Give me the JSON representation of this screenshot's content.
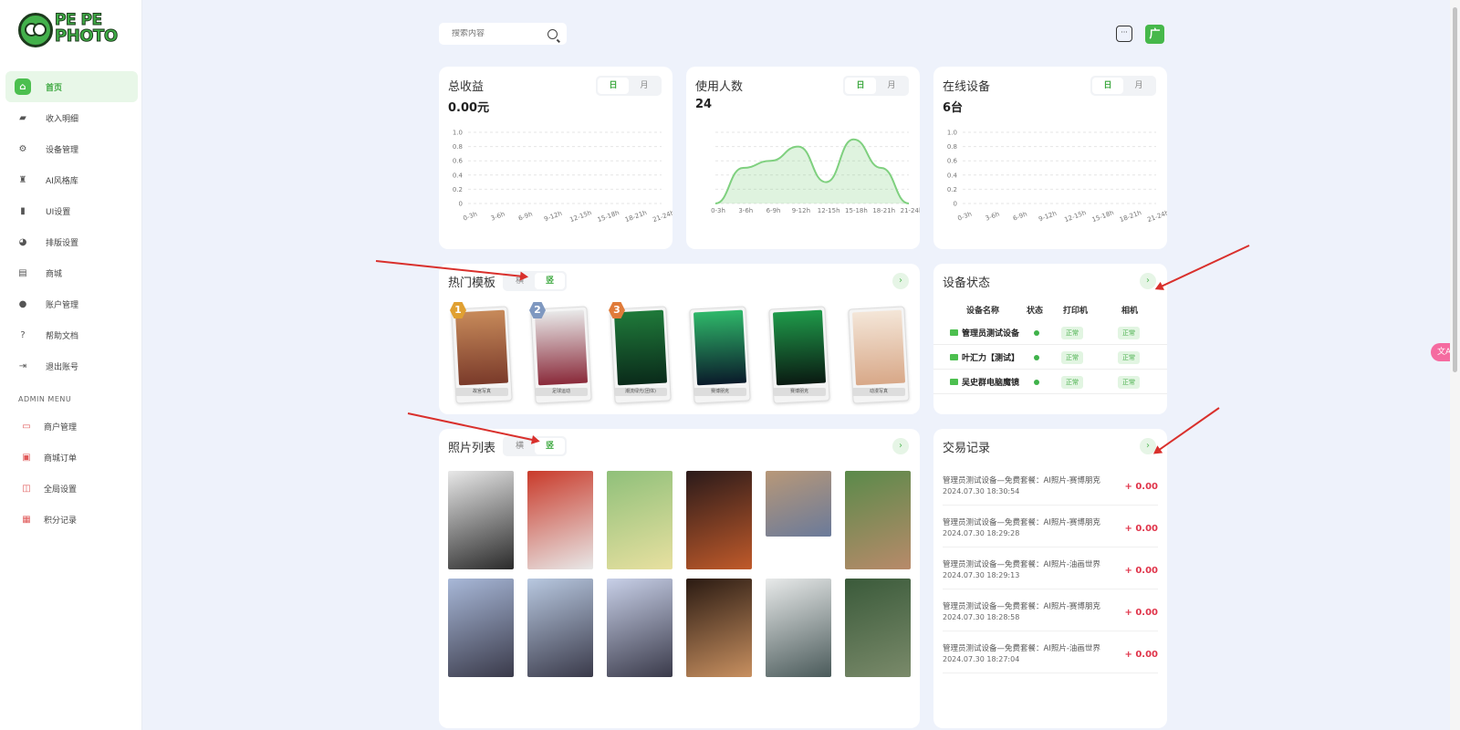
{
  "brand": {
    "line1": "PE PE",
    "line2": "PHOTO"
  },
  "nav": {
    "items": [
      {
        "label": "首页",
        "icon": "home-icon",
        "glyph": "⌂"
      },
      {
        "label": "收入明细",
        "icon": "wallet-icon",
        "glyph": "▰"
      },
      {
        "label": "设备管理",
        "icon": "gear-icon",
        "glyph": "⚙"
      },
      {
        "label": "AI风格库",
        "icon": "stamp-icon",
        "glyph": "♜"
      },
      {
        "label": "UI设置",
        "icon": "phone-icon",
        "glyph": "▮"
      },
      {
        "label": "排版设置",
        "icon": "palette-icon",
        "glyph": "◕"
      },
      {
        "label": "商城",
        "icon": "shop-icon",
        "glyph": "▤"
      },
      {
        "label": "账户管理",
        "icon": "user-icon",
        "glyph": "●"
      },
      {
        "label": "帮助文档",
        "icon": "help-icon",
        "glyph": "?"
      },
      {
        "label": "退出账号",
        "icon": "logout-icon",
        "glyph": "⇥"
      }
    ],
    "admin_title": "ADMIN MENU",
    "admin_items": [
      {
        "label": "商户管理",
        "icon": "monitor-icon",
        "glyph": "▭"
      },
      {
        "label": "商城订单",
        "icon": "bag-icon",
        "glyph": "▣"
      },
      {
        "label": "全局设置",
        "icon": "settings-icon",
        "glyph": "◫"
      },
      {
        "label": "积分记录",
        "icon": "record-icon",
        "glyph": "▦"
      }
    ]
  },
  "topbar": {
    "search_placeholder": "搜索内容",
    "ad_glyph": "广"
  },
  "stats": [
    {
      "title": "总收益",
      "value": "0.00元",
      "seg": [
        "日",
        "月"
      ]
    },
    {
      "title": "使用人数",
      "value": "24",
      "seg": [
        "日",
        "月"
      ]
    },
    {
      "title": "在线设备",
      "value": "6台",
      "seg": [
        "日",
        "月"
      ]
    }
  ],
  "chart_data": [
    {
      "type": "line",
      "title": "",
      "categories": [
        "0-3h",
        "3-6h",
        "6-9h",
        "9-12h",
        "12-15h",
        "15-18h",
        "18-21h",
        "21-24h"
      ],
      "yticks": [
        "0",
        "0.2",
        "0.4",
        "0.6",
        "0.8",
        "1.0"
      ],
      "ylim": [
        0,
        1.0
      ],
      "series": [
        {
          "values": [
            0,
            0,
            0,
            0,
            0,
            0,
            0,
            0
          ]
        }
      ],
      "grid": true
    },
    {
      "type": "area",
      "title": "",
      "categories": [
        "0-3h",
        "3-6h",
        "6-9h",
        "9-12h",
        "12-15h",
        "15-18h",
        "18-21h",
        "21-24h"
      ],
      "ylim": [
        0,
        10
      ],
      "series": [
        {
          "values": [
            0,
            5,
            6,
            8,
            3,
            9,
            5,
            0
          ]
        }
      ],
      "grid": true,
      "color": "#7fd07f"
    },
    {
      "type": "line",
      "title": "",
      "categories": [
        "0-3h",
        "3-6h",
        "6-9h",
        "9-12h",
        "12-15h",
        "15-18h",
        "18-21h",
        "21-24h"
      ],
      "yticks": [
        "0",
        "0.2",
        "0.4",
        "0.6",
        "0.8",
        "1.0"
      ],
      "ylim": [
        0,
        1.0
      ],
      "series": [
        {
          "values": [
            0,
            0,
            0,
            0,
            0,
            0,
            0,
            0
          ]
        }
      ],
      "grid": true
    }
  ],
  "templates": {
    "title": "热门模板",
    "seg": [
      "横",
      "竖"
    ],
    "items": [
      {
        "rank": "1",
        "rank_color": "#e0a032",
        "name": "故宫写真",
        "c1": "#c78a5a",
        "c2": "#7a3a2a"
      },
      {
        "rank": "2",
        "rank_color": "#7f98c0",
        "name": "足球运动",
        "c1": "#e8e8e8",
        "c2": "#8a2a3a"
      },
      {
        "rank": "3",
        "rank_color": "#e07b3a",
        "name": "潮流绿光(团体)",
        "c1": "#1f7a3a",
        "c2": "#0a2a1a"
      },
      {
        "rank": "",
        "rank_color": "",
        "name": "赛博朋克",
        "c1": "#2fb86a",
        "c2": "#0a1a2a"
      },
      {
        "rank": "",
        "rank_color": "",
        "name": "赛博朋克",
        "c1": "#1f9a4a",
        "c2": "#0a1a12"
      },
      {
        "rank": "",
        "rank_color": "",
        "name": "动漫写真",
        "c1": "#f4e6d8",
        "c2": "#d8a888"
      }
    ]
  },
  "devices": {
    "title": "设备状态",
    "headers": [
      "设备名称",
      "状态",
      "打印机",
      "相机"
    ],
    "rows": [
      {
        "name": "管理员测试设备",
        "printer": "正常",
        "camera": "正常"
      },
      {
        "name": "叶汇力【测试】",
        "printer": "正常",
        "camera": "正常"
      },
      {
        "name": "吴史群电脑魔镜",
        "printer": "正常",
        "camera": "正常"
      }
    ]
  },
  "photos": {
    "title": "照片列表",
    "seg": [
      "横",
      "竖"
    ],
    "items": [
      {
        "c1": "#e8e8e8",
        "c2": "#2a2a2a"
      },
      {
        "c1": "#c93a2a",
        "c2": "#e8e8e8"
      },
      {
        "c1": "#8fc07a",
        "c2": "#e8e0a0"
      },
      {
        "c1": "#2a1a1a",
        "c2": "#c05a2a"
      },
      {
        "c1": "#b89878",
        "c2": "#6a7a9a"
      },
      {
        "c1": "#5a8a4a",
        "c2": "#b88a6a"
      },
      {
        "c1": "#a8b8d8",
        "c2": "#3a3a4a"
      },
      {
        "c1": "#b8c8e0",
        "c2": "#3a3a4a"
      },
      {
        "c1": "#c8d0e8",
        "c2": "#3a3a4a"
      },
      {
        "c1": "#2a1a12",
        "c2": "#c89060"
      },
      {
        "c1": "#e8eaea",
        "c2": "#4a5a5a"
      },
      {
        "c1": "#3a5a3a",
        "c2": "#7a8a6a"
      }
    ]
  },
  "transactions": {
    "title": "交易记录",
    "items": [
      {
        "desc": "管理员测试设备—免费套餐：AI照片-赛博朋克",
        "time": "2024.07.30 18:30:54",
        "amount": "+ 0.00"
      },
      {
        "desc": "管理员测试设备—免费套餐：AI照片-赛博朋克",
        "time": "2024.07.30 18:29:28",
        "amount": "+ 0.00"
      },
      {
        "desc": "管理员测试设备—免费套餐：AI照片-油画世界",
        "time": "2024.07.30 18:29:13",
        "amount": "+ 0.00"
      },
      {
        "desc": "管理员测试设备—免费套餐：AI照片-赛博朋克",
        "time": "2024.07.30 18:28:58",
        "amount": "+ 0.00"
      },
      {
        "desc": "管理员测试设备—免费套餐：AI照片-油画世界",
        "time": "2024.07.30 18:27:04",
        "amount": "+ 0.00"
      }
    ]
  },
  "translate_label": "文A"
}
